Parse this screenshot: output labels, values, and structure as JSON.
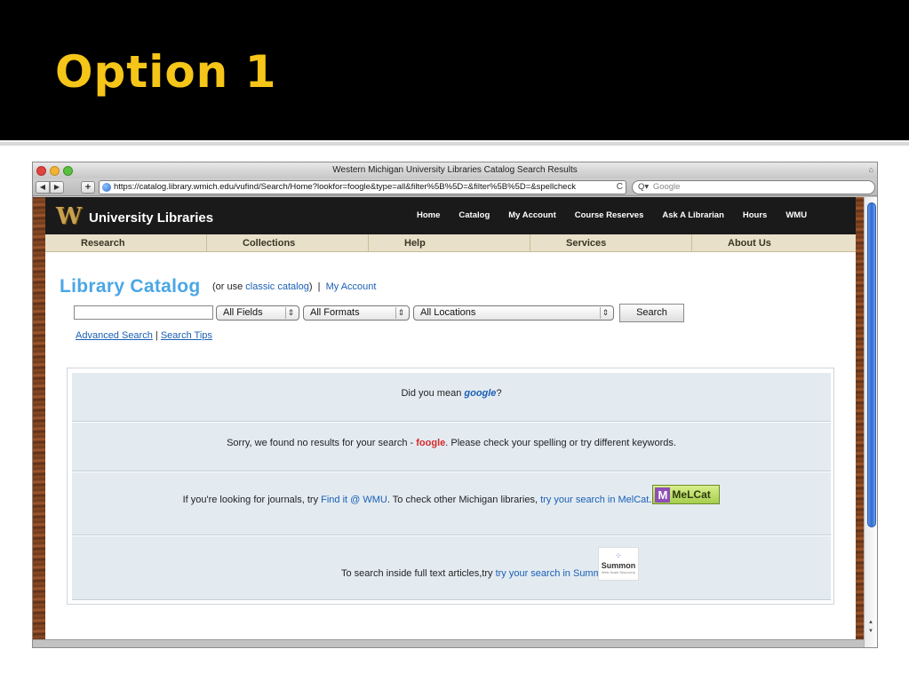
{
  "slide": {
    "title": "Option 1"
  },
  "browser": {
    "window_title": "Western Michigan University Libraries Catalog Search Results",
    "url": "https://catalog.library.wmich.edu/vufind/Search/Home?lookfor=foogle&type=all&filter%5B%5D=&filter%5B%5D=&spellcheck",
    "search_placeholder": "Google",
    "back_glyph": "◀",
    "forward_glyph": "▶",
    "add_glyph": "+",
    "reload_glyph": "C",
    "search_glyph": "Q▾"
  },
  "site": {
    "logo_letter": "W",
    "title": "University Libraries",
    "top_nav": [
      "Home",
      "Catalog",
      "My Account",
      "Course Reserves",
      "Ask A Librarian",
      "Hours",
      "WMU"
    ],
    "main_nav": [
      "Research",
      "Collections",
      "Help",
      "Services",
      "About Us"
    ]
  },
  "catalog": {
    "heading": "Library Catalog",
    "prefix_text": "(or use ",
    "classic_link": "classic catalog",
    "suffix_text": ")  |  ",
    "account_link": "My Account",
    "type_select": "All Fields",
    "format_select": "All Formats",
    "location_select": "All Locations",
    "search_button": "Search",
    "advanced_link": "Advanced Search",
    "separator": " | ",
    "tips_link": "Search Tips"
  },
  "results": {
    "did_you_mean_prefix": "Did you mean ",
    "suggestion": "google",
    "did_you_mean_suffix": "?",
    "sorry_prefix": "Sorry, we found no results for your search - ",
    "query": "foogle",
    "sorry_suffix": ". Please check your spelling or try different keywords.",
    "journals_prefix": "If you're looking for journals, try ",
    "findit_link": "Find it @ WMU",
    "journals_middle": ". To check other Michigan libraries, ",
    "melcat_link": "try your search in MelCat",
    "journals_suffix": ".",
    "melcat_badge_letter": "M",
    "melcat_badge_text": "MeLCat",
    "summon_prefix": "To search inside full text articles,try ",
    "summon_link": "try your search in Summon",
    "summon_suffix": ".",
    "summon_logo_word": "Summon",
    "summon_logo_sub": "Web-Scale Discovery"
  },
  "colors": {
    "slide_title": "#f5c518",
    "catalog_heading": "#4aa7e6",
    "link": "#1a5fb4",
    "query_highlight": "#d52a2a",
    "result_row_bg": "#e3ebf1"
  }
}
